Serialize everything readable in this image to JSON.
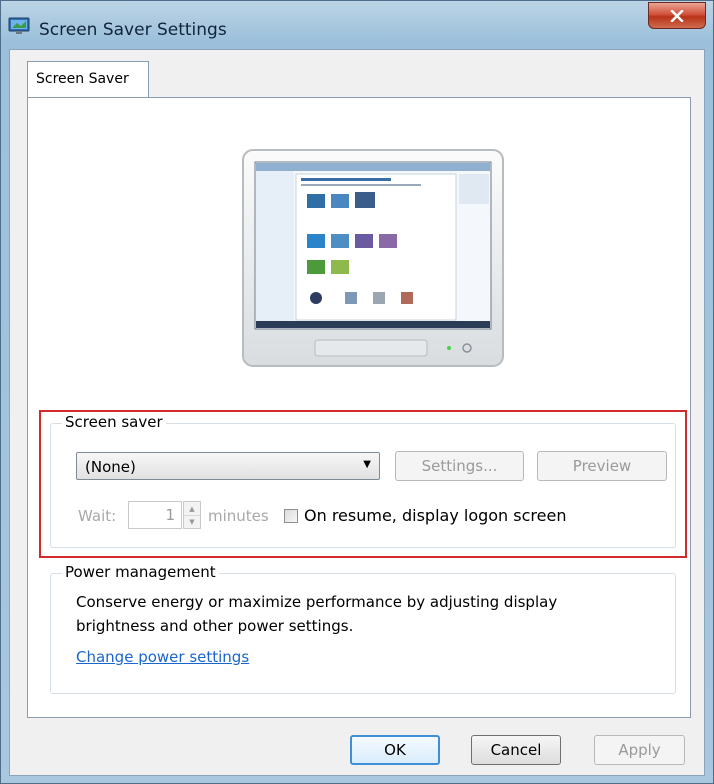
{
  "window": {
    "title": "Screen Saver Settings",
    "close_label": "x"
  },
  "tabs": [
    {
      "label": "Screen Saver"
    }
  ],
  "screen_saver": {
    "group_label": "Screen saver",
    "selected": "(None)",
    "settings_label": "Settings...",
    "preview_label": "Preview",
    "wait_label": "Wait:",
    "wait_value": "1",
    "minutes_label": "minutes",
    "resume_label": "On resume, display logon screen",
    "resume_checked": false
  },
  "power": {
    "group_label": "Power management",
    "description": "Conserve energy or maximize performance by adjusting display brightness and other power settings.",
    "link_label": "Change power settings"
  },
  "footer": {
    "ok_label": "OK",
    "cancel_label": "Cancel",
    "apply_label": "Apply"
  },
  "colors": {
    "highlight": "#d22b2b",
    "link": "#1a66cc",
    "close_button": "#c8432a"
  }
}
